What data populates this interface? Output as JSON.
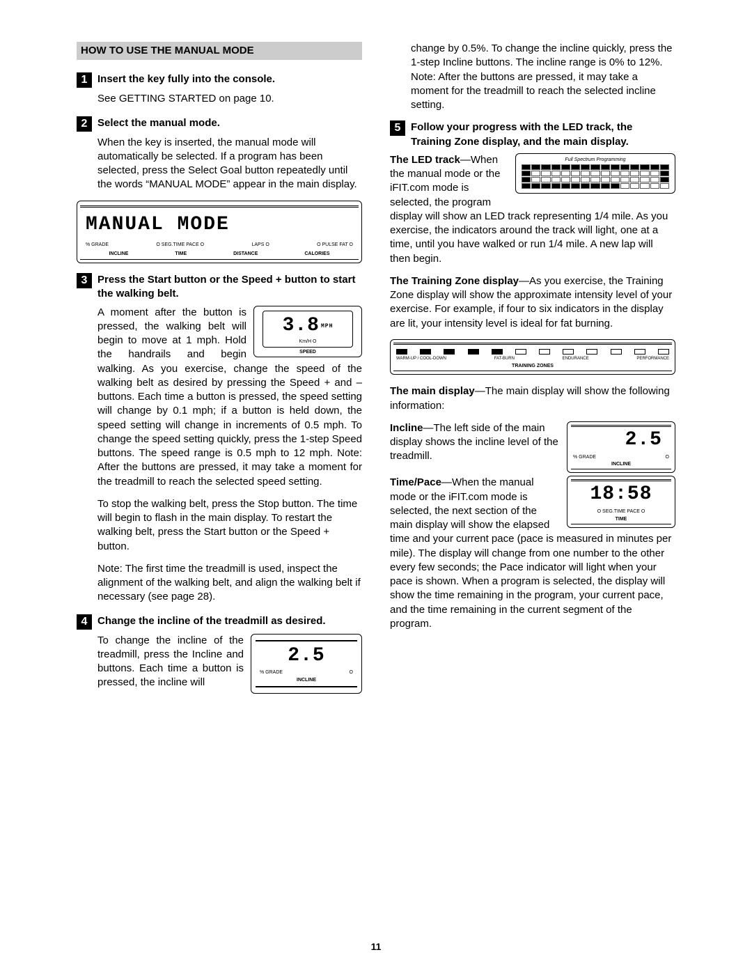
{
  "page_number": "11",
  "section_header": "HOW TO USE THE MANUAL MODE",
  "steps": {
    "s1": {
      "num": "1",
      "title": "Insert the key fully into the console.",
      "body": "See GETTING STARTED on page 10."
    },
    "s2": {
      "num": "2",
      "title": "Select the manual mode.",
      "body": "When the key is inserted, the manual mode will automatically be selected. If a program has been selected, press the Select Goal button repeatedly until the words “MANUAL MODE” appear in the main display."
    },
    "s3": {
      "num": "3",
      "title": "Press the Start button or the Speed + button to start the walking belt.",
      "p1": "A moment after the button is pressed, the walking belt will begin to move at 1 mph. Hold the handrails and begin walking. As you exercise, change the speed of the walking belt as desired by pressing the Speed + and – buttons. Each time a button is pressed, the speed setting will change by 0.1 mph; if a button is held down, the speed setting will change in increments of 0.5 mph. To change the speed setting quickly, press the 1-step Speed buttons. The speed range is 0.5 mph to 12 mph. Note: After the buttons are pressed, it may take a moment for the treadmill to reach the selected speed setting.",
      "p2": "To stop the walking belt, press the Stop button. The time will begin to flash in the main display. To restart the walking belt, press the Start button or the Speed + button.",
      "p3": "Note: The first time the treadmill is used, inspect the alignment of the walking belt, and align the walking belt if necessary (see page 28)."
    },
    "s4": {
      "num": "4",
      "title": "Change the incline of the treadmill as desired.",
      "p1_left": "To change the incline of the treadmill, press the Incline and buttons. Each time a button is pressed, the incline will",
      "p1_right_top": "change by 0.5%. To change the incline quickly, press the 1-step Incline buttons. The incline range is 0% to 12%. Note: After the buttons are pressed, it may take a moment for the treadmill to reach the selected incline setting."
    },
    "s5": {
      "num": "5",
      "title": "Follow your progress with the LED track, the Training Zone display, and the main display.",
      "led_bold": "The LED track",
      "led_text": "—When the manual mode or the iFIT.com mode is selected, the program display will show an LED track representing 1/4 mile. As you exercise, the indicators around the track will light, one at a time, until you have walked or run 1/4 mile. A new lap will then begin.",
      "zone_bold": "The Training Zone display",
      "zone_text": "—As you exercise, the Training Zone display will show the approximate intensity level of your exercise. For example, if four to six indicators in the display are lit, your intensity level is ideal for fat burning.",
      "main_bold": "The main display",
      "main_text": "—The main display will show the following information:",
      "incline_bold": "Incline",
      "incline_text": "—The left side of the main display shows the incline level of the treadmill.",
      "time_bold": "Time/Pace",
      "time_text": "—When the manual mode or the iFIT.com mode is selected, the next section of the main display will show the elapsed time and your current pace (pace is measured in minutes per mile). The display will change from one number to the other every few seconds; the Pace indicator will light when your pace is shown. When a program is selected, the display will show the time remaining in the program, your current pace, and the time remaining in the current segment of the program."
    }
  },
  "lcd": {
    "manual_mode": "MANUAL  MODE",
    "labels_row1": [
      "% GRADE",
      "O SEG.TIME  PACE O",
      "LAPS O",
      "O PULSE  FAT O"
    ],
    "labels_row2": [
      "INCLINE",
      "TIME",
      "DISTANCE",
      "CALORIES"
    ],
    "speed_value": "3.8",
    "speed_mph": "MPH",
    "speed_kmh": "Km/H O",
    "speed_label": "SPEED",
    "incline_value": "2.5",
    "incline_grade": "% GRADE",
    "incline_label": "INCLINE",
    "led_title": "Full Spectrum Programming",
    "time_value": "18:58",
    "time_row1_left": "O SEG.TIME  PACE O",
    "time_label": "TIME",
    "zone_labels": [
      "WARM-UP / COOL-DOWN",
      "FAT-BURN",
      "ENDURANCE",
      "PERFORMANCE"
    ],
    "zone_title": "TRAINING ZONES"
  }
}
